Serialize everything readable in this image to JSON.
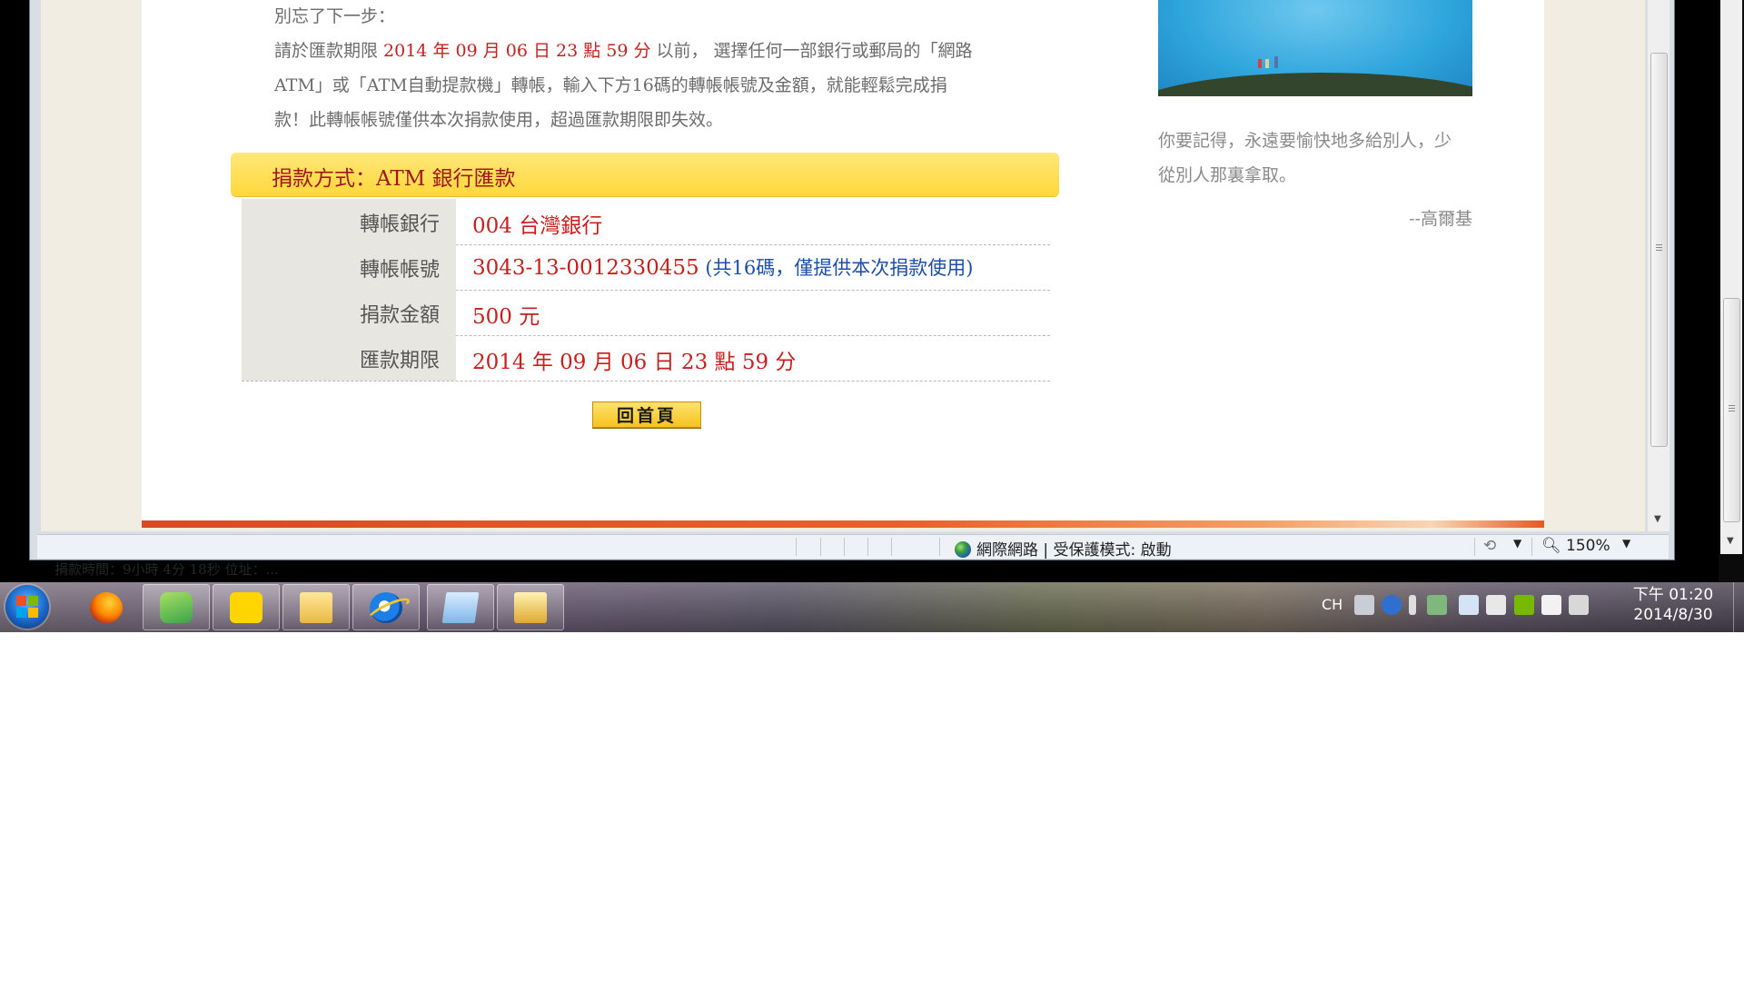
{
  "background_text": "捐款時間：9小時 4分 18秒   位址：...",
  "page": {
    "reminder_line1": "別忘了下一步：",
    "instructions": [
      [
        {
          "t": "請於匯款期限 ",
          "c": "gray"
        },
        {
          "t": "2014 年 09 月 06 日 23 點 59 分",
          "c": "red"
        },
        {
          "t": " 以前， 選擇任何一部銀行或郵局的「網路",
          "c": "gray"
        }
      ],
      [
        {
          "t": "ATM」或「ATM自動提款機」轉帳，輸入下方16碼的轉帳帳號及金額，就能輕鬆完成捐",
          "c": "gray"
        }
      ],
      [
        {
          "t": "款！此轉帳帳號僅供本次捐款使用，超過匯款期限即失效。",
          "c": "gray"
        }
      ]
    ],
    "method_title": "捐款方式：ATM 銀行匯款",
    "rows": [
      {
        "label": "轉帳銀行",
        "value": "004 台灣銀行",
        "note": ""
      },
      {
        "label": "轉帳帳號",
        "value": "3043-13-0012330455",
        "note": " (共16碼，僅提供本次捐款使用)"
      },
      {
        "label": "捐款金額",
        "value": "500 元",
        "note": ""
      },
      {
        "label": "匯款期限",
        "value": "2014 年 09 月 06 日 23 點 59 分",
        "note": ""
      }
    ],
    "home_button": "回首頁",
    "quote_line1": "你要記得，永遠要愉快地多給別人，少",
    "quote_line2": "從別人那裏拿取。",
    "quote_author": "--高爾基"
  },
  "statusbar": {
    "zone": "網際網路 | 受保護模式: 啟動",
    "zoom": "150%"
  },
  "taskbar": {
    "apps": [
      {
        "name": "firefox-icon",
        "open": false
      },
      {
        "name": "mail-app-icon",
        "open": true
      },
      {
        "name": "kakao-icon",
        "open": true
      },
      {
        "name": "file-explorer-icon",
        "open": true
      },
      {
        "name": "internet-explorer-icon",
        "open": true
      },
      {
        "name": "notepad-icon",
        "open": true
      },
      {
        "name": "photo-viewer-icon",
        "open": true
      }
    ],
    "ime": "CH",
    "clock_line1": "下午 01:20",
    "clock_line2": "2014/8/30"
  },
  "colors": {
    "accent_red": "#c81e1e",
    "note_blue": "#1d4fa8",
    "yellow_bar": "#ffd83a",
    "page_rule": "#e9612c"
  }
}
